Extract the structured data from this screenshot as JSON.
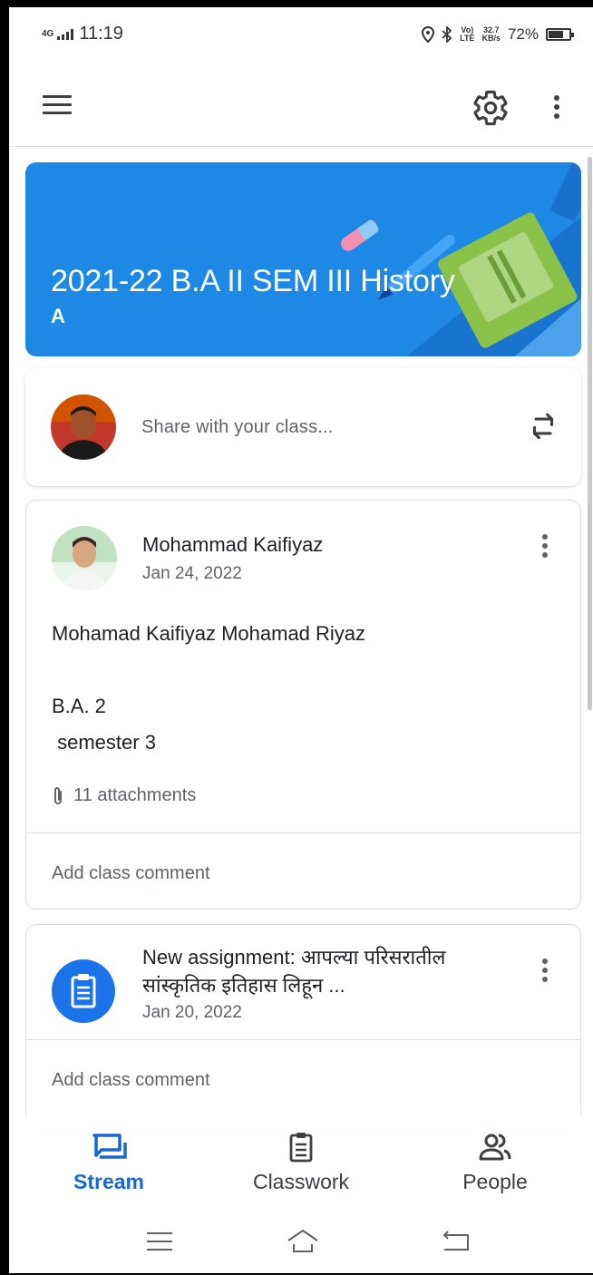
{
  "status_bar": {
    "network": "4G",
    "time": "11:19",
    "net_type_top": "Vo)",
    "net_type_bottom": "LTE",
    "speed_value": "32.7",
    "speed_unit": "KB/s",
    "battery_text": "72%",
    "battery_level": 0.72
  },
  "app_bar": {
    "menu_icon": "hamburger-menu",
    "settings_icon": "gear",
    "more_icon": "more-vertical"
  },
  "banner": {
    "title": "2021-22 B.A II SEM III History",
    "section": "A",
    "color": "#1e88e5"
  },
  "share": {
    "placeholder": "Share with your class..."
  },
  "post": {
    "author": "Mohammad Kaifiyaz",
    "date": "Jan 24, 2022",
    "lines": [
      "Mohamad Kaifiyaz Mohamad Riyaz",
      "B.A. 2",
      " semester 3"
    ],
    "attachments": "11 attachments",
    "comment_label": "Add class comment"
  },
  "assignment": {
    "title": "New assignment: आपल्या परिसरातील सांस्कृतिक इतिहास लिहून ...",
    "date": "Jan 20, 2022",
    "comment_label": "Add class comment",
    "icon_color": "#1a73e8"
  },
  "bottom_nav": {
    "items": [
      {
        "label": "Stream",
        "icon": "stream-icon",
        "active": true
      },
      {
        "label": "Classwork",
        "icon": "classwork-icon",
        "active": false
      },
      {
        "label": "People",
        "icon": "people-icon",
        "active": false
      }
    ],
    "accent": "#1967d2"
  },
  "system_nav": {
    "buttons": [
      "recent-apps",
      "home",
      "back"
    ]
  }
}
